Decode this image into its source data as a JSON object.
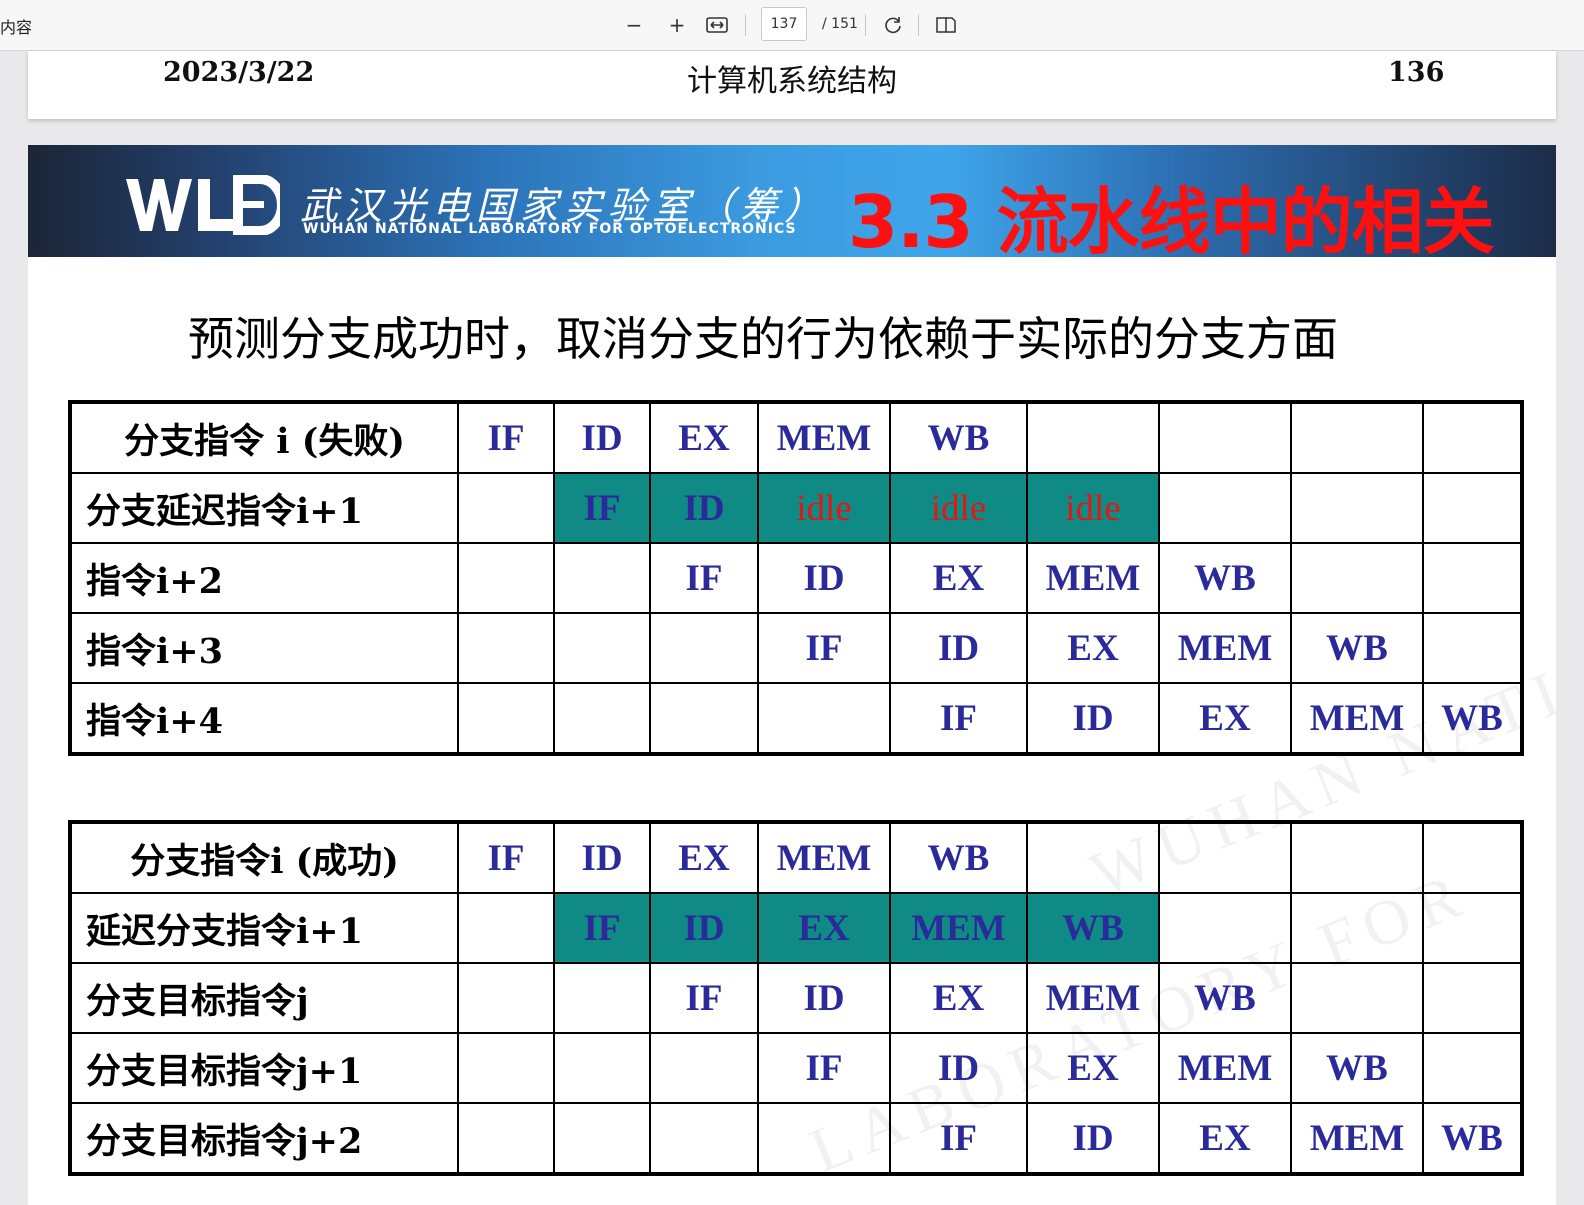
{
  "toolbar": {
    "left_text": "内容",
    "zoom_out": "−",
    "zoom_in": "+",
    "current_page": "137",
    "total_pages": "/ 151"
  },
  "prev_page": {
    "date": "2023/3/22",
    "title": "计算机系统结构",
    "page_number": "136"
  },
  "banner": {
    "lab_name_cn": "武汉光电国家实验室（筹）",
    "lab_name_en": "WUHAN NATIONAL LABORATORY FOR OPTOELECTRONICS",
    "slide_title": "3.3 流水线中的相关"
  },
  "subtitle": "预测分支成功时，取消分支的行为依赖于实际的分支方面",
  "table1": {
    "rows": [
      {
        "label": "分支指令 i (失败)",
        "cells": [
          "IF",
          "ID",
          "EX",
          "MEM",
          "WB",
          "",
          "",
          "",
          ""
        ]
      },
      {
        "label": "分支延迟指令i+1",
        "cells": [
          "",
          "IF",
          "ID",
          "idle",
          "idle",
          "idle",
          "",
          "",
          ""
        ]
      },
      {
        "label": "指令i+2",
        "cells": [
          "",
          "",
          "IF",
          "ID",
          "EX",
          "MEM",
          "WB",
          "",
          ""
        ]
      },
      {
        "label": "指令i+3",
        "cells": [
          "",
          "",
          "",
          "IF",
          "ID",
          "EX",
          "MEM",
          "WB",
          ""
        ]
      },
      {
        "label": "指令i+4",
        "cells": [
          "",
          "",
          "",
          "",
          "IF",
          "ID",
          "EX",
          "MEM",
          "WB"
        ]
      }
    ]
  },
  "table2": {
    "rows": [
      {
        "label": "分支指令i (成功)",
        "cells": [
          "IF",
          "ID",
          "EX",
          "MEM",
          "WB",
          "",
          "",
          "",
          ""
        ]
      },
      {
        "label": "延迟分支指令i+1",
        "cells": [
          "",
          "IF",
          "ID",
          "EX",
          "MEM",
          "WB",
          "",
          "",
          ""
        ]
      },
      {
        "label": "分支目标指令j",
        "cells": [
          "",
          "",
          "IF",
          "ID",
          "EX",
          "MEM",
          "WB",
          "",
          ""
        ]
      },
      {
        "label": "分支目标指令j+1",
        "cells": [
          "",
          "",
          "",
          "IF",
          "ID",
          "EX",
          "MEM",
          "WB",
          ""
        ]
      },
      {
        "label": "分支目标指令j+2",
        "cells": [
          "",
          "",
          "",
          "",
          "IF",
          "ID",
          "EX",
          "MEM",
          "WB"
        ]
      }
    ]
  },
  "colors": {
    "stage_text": "#2a2a9a",
    "highlight": "#0f8a84",
    "idle_text": "#e21818",
    "title_red": "#ff1010"
  }
}
